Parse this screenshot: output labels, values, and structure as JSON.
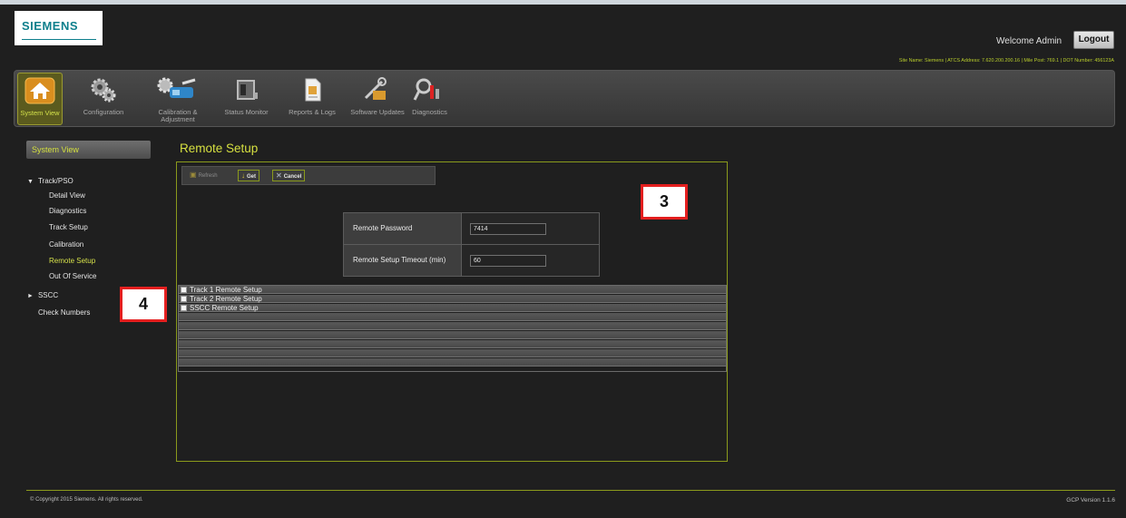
{
  "header": {
    "logo": "SIEMENS",
    "welcome": "Welcome Admin",
    "logout_label": "Logout",
    "site_info": "Site Name: Siemens | ATCS Address: 7.620.200.200.16 | Mile Post: 769.1 | DOT Number: 456123A"
  },
  "nav": {
    "items": [
      {
        "label": "System View",
        "icon": "home-icon"
      },
      {
        "label": "Configuration",
        "icon": "gears-icon"
      },
      {
        "label": "Calibration & Adjustment",
        "icon": "calibration-icon"
      },
      {
        "label": "Status Monitor",
        "icon": "monitor-icon"
      },
      {
        "label": "Reports & Logs",
        "icon": "document-icon"
      },
      {
        "label": "Software Updates",
        "icon": "tools-icon"
      },
      {
        "label": "Diagnostics",
        "icon": "diagnostics-icon"
      }
    ]
  },
  "sidebar": {
    "heading": "System View",
    "items": [
      {
        "label": "Track/PSO",
        "arrow": "▼"
      },
      {
        "label": "Detail View"
      },
      {
        "label": "Diagnostics"
      },
      {
        "label": "Track Setup"
      },
      {
        "label": "Calibration"
      },
      {
        "label": "Remote Setup"
      },
      {
        "label": "Out Of Service"
      },
      {
        "label": "SSCC",
        "arrow": "►"
      },
      {
        "label": "Check Numbers"
      }
    ]
  },
  "main": {
    "title": "Remote Setup",
    "toolbar": {
      "refresh": "Refresh",
      "get": "Get",
      "cancel": "Cancel"
    },
    "form": {
      "password_label": "Remote Password",
      "password_value": "7414",
      "timeout_label": "Remote Setup Timeout (min)",
      "timeout_value": "60"
    },
    "setups": [
      {
        "label": "Track 1 Remote Setup"
      },
      {
        "label": "Track 2 Remote Setup"
      },
      {
        "label": "SSCC Remote Setup"
      }
    ]
  },
  "callouts": {
    "c3": "3",
    "c4": "4"
  },
  "footer": {
    "copyright": "© Copyright 2015 Siemens. All rights reserved.",
    "version": "GCP Version 1.1.6"
  },
  "colors": {
    "accent": "#d6e040",
    "panel_border": "#8a9a1c",
    "callout_border": "#e41f1f",
    "background": "#1f1f1f"
  }
}
